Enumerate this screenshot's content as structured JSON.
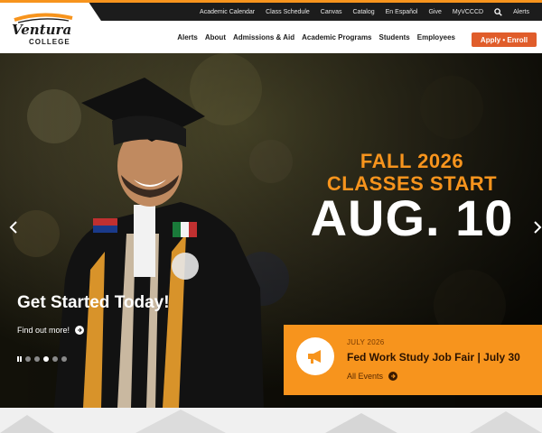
{
  "utility_nav": {
    "items": [
      "Academic Calendar",
      "Class Schedule",
      "Canvas",
      "Catalog",
      "En Español",
      "Give",
      "MyVCCCD"
    ],
    "alerts_label": "Alerts"
  },
  "logo": {
    "script_text": "Ventura",
    "sub_text": "COLLEGE"
  },
  "main_nav": {
    "items": [
      "Alerts",
      "About",
      "Admissions & Aid",
      "Academic Programs",
      "Students",
      "Employees"
    ],
    "apply_label": "Apply • Enroll"
  },
  "hero": {
    "line1": "FALL 2026",
    "line2": "CLASSES START",
    "line3": "AUG. 10",
    "cta_title": "Get Started Today!",
    "cta_link": "Find out more!",
    "slide_count": 5,
    "active_slide": 3
  },
  "event": {
    "date": "JULY 2026",
    "title": "Fed Work Study Job Fair | July 30",
    "link": "All Events"
  },
  "colors": {
    "accent": "#f7941d",
    "apply": "#e05d2b",
    "utility_bg": "#1c1c1c"
  }
}
